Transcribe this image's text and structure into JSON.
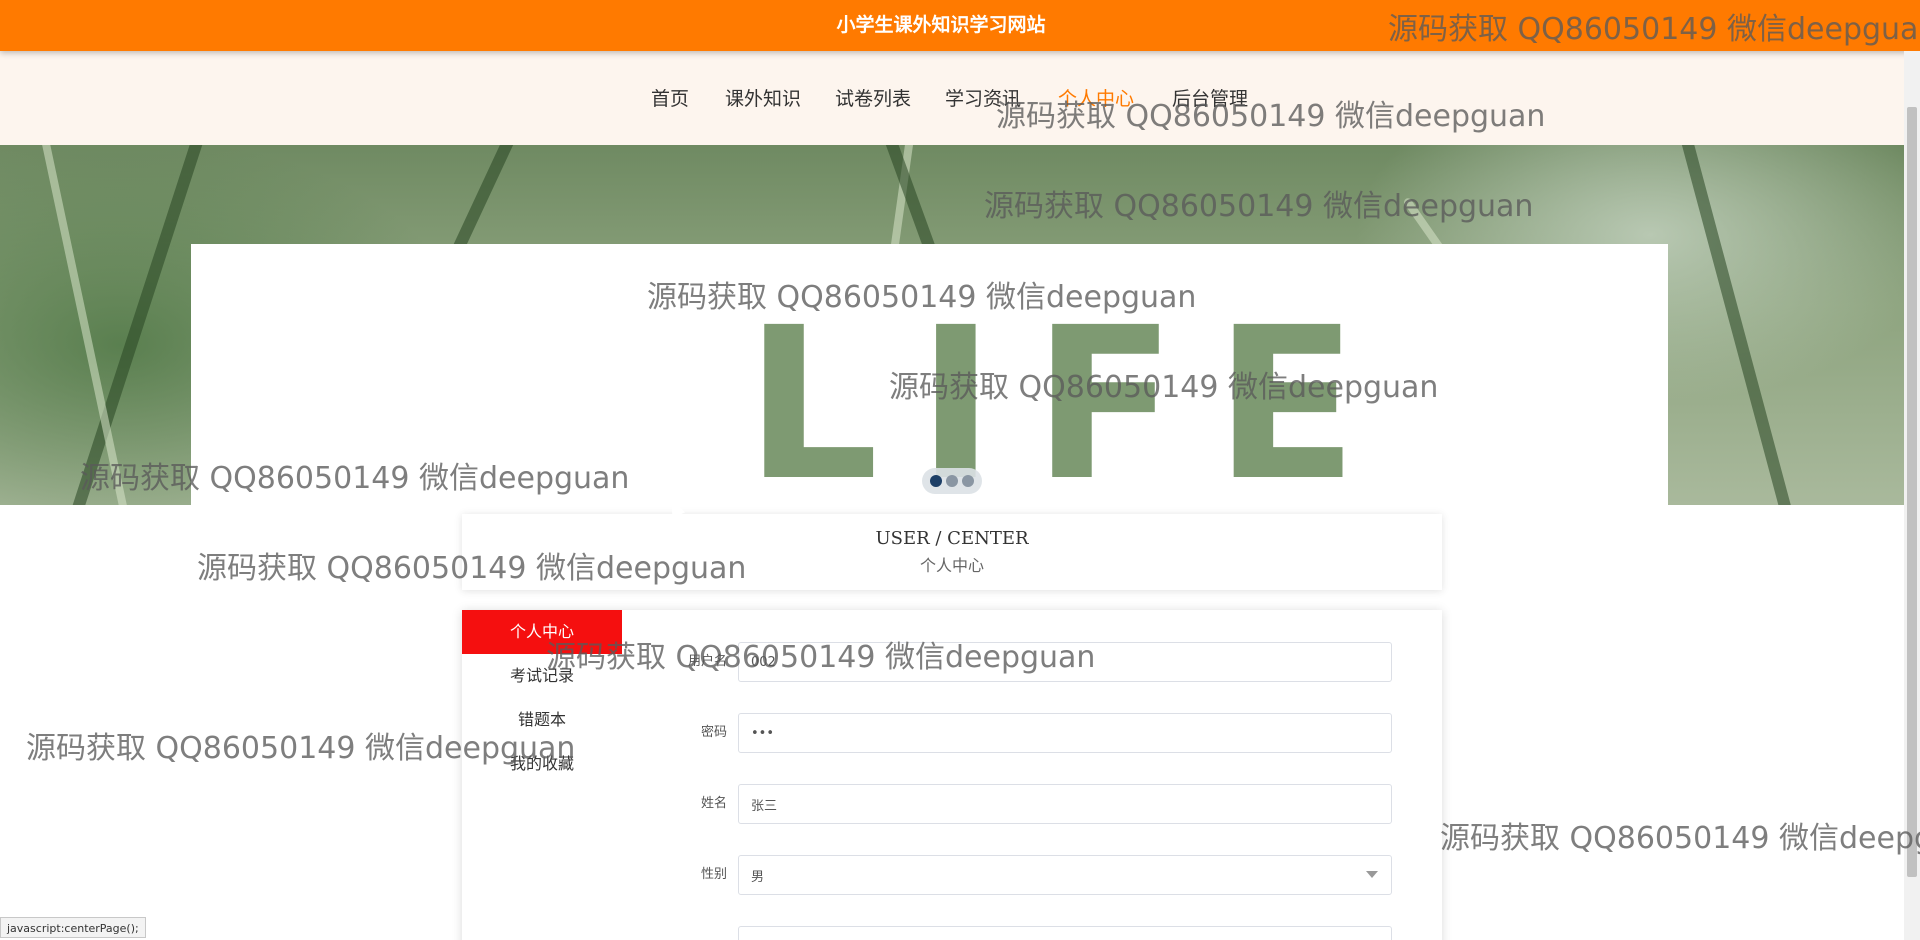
{
  "header": {
    "site_title": "小学生课外知识学习网站"
  },
  "nav": {
    "items": [
      {
        "label": "首页"
      },
      {
        "label": "课外知识"
      },
      {
        "label": "试卷列表"
      },
      {
        "label": "学习资讯"
      },
      {
        "label": "个人中心",
        "active": true
      },
      {
        "label": "后台管理"
      }
    ]
  },
  "banner": {
    "text": "LIFE"
  },
  "section": {
    "title_en": "USER / CENTER",
    "title_cn": "个人中心"
  },
  "sidebar": {
    "items": [
      {
        "label": "个人中心",
        "active": true
      },
      {
        "label": "考试记录"
      },
      {
        "label": "错题本"
      },
      {
        "label": "我的收藏"
      }
    ]
  },
  "form": {
    "username": {
      "label": "用户名",
      "value": "002"
    },
    "password": {
      "label": "密码",
      "value": "•••"
    },
    "name": {
      "label": "姓名",
      "value": "张三"
    },
    "gender": {
      "label": "性别",
      "value": "男"
    }
  },
  "status_bar": {
    "text": "javascript:centerPage();"
  },
  "watermark": {
    "text": "源码获取 QQ86050149 微信deepguan"
  },
  "colors": {
    "header_bg": "#ff7a00",
    "nav_active": "#ff7a00",
    "sidebar_active_bg": "#f50f0f"
  }
}
